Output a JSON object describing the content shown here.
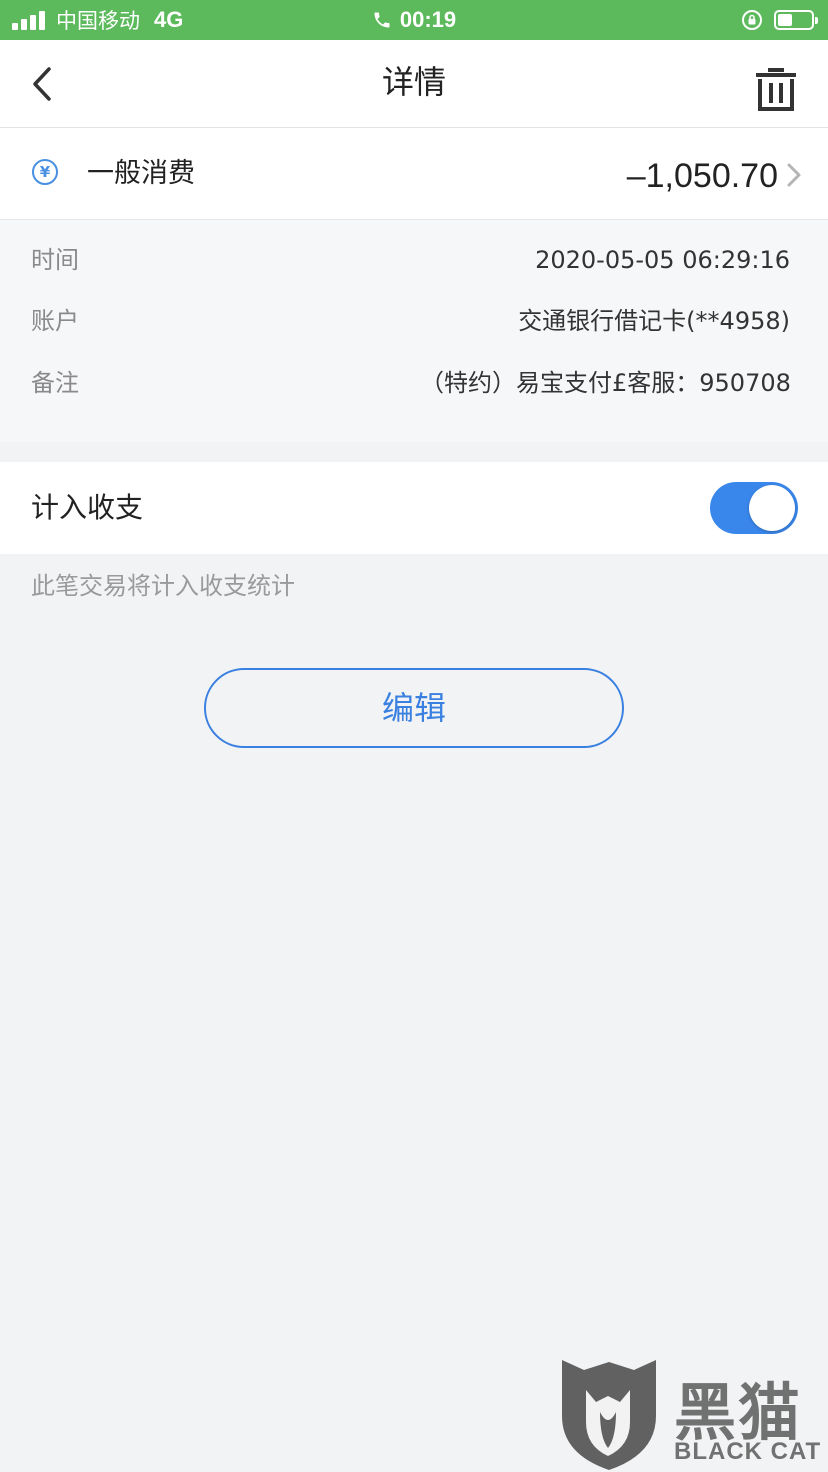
{
  "status_bar": {
    "carrier": "中国移动",
    "network": "4G",
    "time": "00:19",
    "battery_level": 0.45
  },
  "nav": {
    "title": "详情",
    "back_icon": "chevron-left-icon",
    "delete_icon": "trash-icon"
  },
  "transaction": {
    "category": "一般消费",
    "category_icon": "yen-icon",
    "amount": "–1,050.70"
  },
  "details": {
    "time_label": "时间",
    "time_value": "2020-05-05 06:29:16",
    "account_label": "账户",
    "account_value": "交通银行借记卡(**4958)",
    "note_label": "备注",
    "note_value": "（特约）易宝支付£客服：950708"
  },
  "include_toggle": {
    "label": "计入收支",
    "enabled": true,
    "hint": "此笔交易将计入收支统计"
  },
  "edit_button": {
    "label": "编辑"
  },
  "watermark": {
    "text": "黑猫",
    "subtext": "BLACK CAT"
  },
  "colors": {
    "status_bar": "#5cba5c",
    "accent": "#3a80e0",
    "background": "#f2f3f5"
  }
}
